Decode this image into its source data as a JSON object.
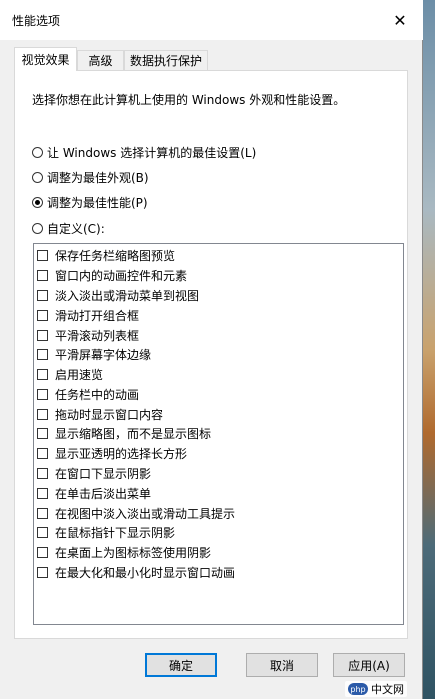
{
  "window": {
    "title": "性能选项"
  },
  "tabs": [
    {
      "label": "视觉效果",
      "active": true
    },
    {
      "label": "高级",
      "active": false
    },
    {
      "label": "数据执行保护",
      "active": false
    }
  ],
  "description": "选择你想在此计算机上使用的 Windows 外观和性能设置。",
  "radios": [
    {
      "label": "让 Windows 选择计算机的最佳设置(L)",
      "selected": false
    },
    {
      "label": "调整为最佳外观(B)",
      "selected": false
    },
    {
      "label": "调整为最佳性能(P)",
      "selected": true
    },
    {
      "label": "自定义(C):",
      "selected": false
    }
  ],
  "effects": [
    "保存任务栏缩略图预览",
    "窗口内的动画控件和元素",
    "淡入淡出或滑动菜单到视图",
    "滑动打开组合框",
    "平滑滚动列表框",
    "平滑屏幕字体边缘",
    "启用速览",
    "任务栏中的动画",
    "拖动时显示窗口内容",
    "显示缩略图，而不是显示图标",
    "显示亚透明的选择长方形",
    "在窗口下显示阴影",
    "在单击后淡出菜单",
    "在视图中淡入淡出或滑动工具提示",
    "在鼠标指针下显示阴影",
    "在桌面上为图标标签使用阴影",
    "在最大化和最小化时显示窗口动画"
  ],
  "buttons": {
    "ok": "确定",
    "cancel": "取消",
    "apply": "应用(A)"
  },
  "watermark": {
    "badge": "php",
    "text": "中文网"
  },
  "colors": {
    "accent": "#0078d7",
    "dialog_bg": "#f0f0f0"
  }
}
